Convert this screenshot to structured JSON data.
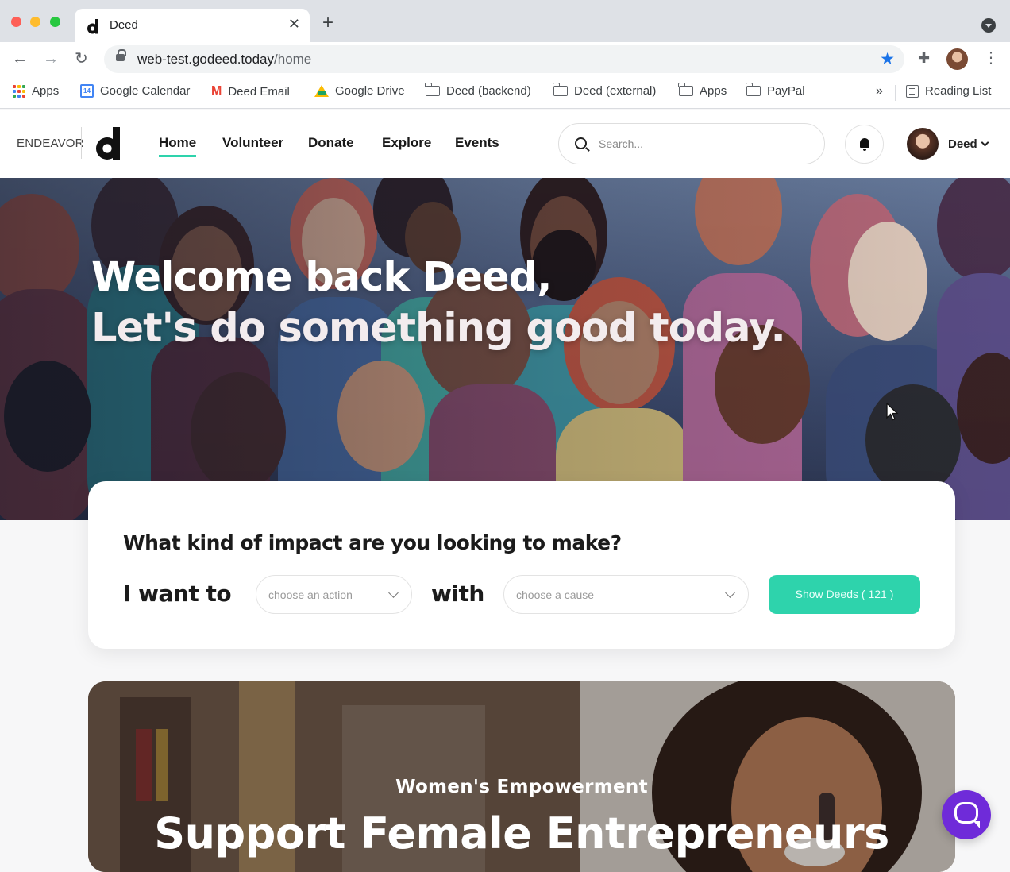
{
  "browser": {
    "tab_title": "Deed",
    "url_host": "web-test.godeed.today",
    "url_path": "/home",
    "bookmarks": [
      {
        "label": "Apps",
        "icon": "apps-grid-icon"
      },
      {
        "label": "Google Calendar",
        "icon": "google-calendar-icon"
      },
      {
        "label": "Deed Email",
        "icon": "gmail-icon"
      },
      {
        "label": "Google Drive",
        "icon": "google-drive-icon"
      },
      {
        "label": "Deed (backend)",
        "icon": "folder-icon"
      },
      {
        "label": "Deed (external)",
        "icon": "folder-icon"
      },
      {
        "label": "Apps",
        "icon": "folder-icon"
      },
      {
        "label": "PayPal",
        "icon": "folder-icon"
      }
    ],
    "overflow_label": "»",
    "reading_list": "Reading List",
    "calendar_day": "14"
  },
  "site": {
    "brand_text": "ENDEAVOR",
    "nav": [
      "Home",
      "Volunteer",
      "Donate",
      "Explore",
      "Events"
    ],
    "active_nav": "Home",
    "search_placeholder": "Search...",
    "user_name": "Deed"
  },
  "hero": {
    "line1": "Welcome back Deed,",
    "line2": "Let's do something good today."
  },
  "impact": {
    "question": "What kind of impact are you looking to make?",
    "i_want_to": "I want to",
    "action_placeholder": "choose an action",
    "with": "with",
    "cause_placeholder": "choose a cause",
    "show_button": "Show Deeds ( 121 )"
  },
  "feature": {
    "kicker": "Women's Empowerment",
    "title": "Support Female Entrepreneurs"
  },
  "colors": {
    "accent": "#2ed3ac",
    "chat": "#6f2bd9",
    "bookmark_star": "#1a73e8"
  }
}
